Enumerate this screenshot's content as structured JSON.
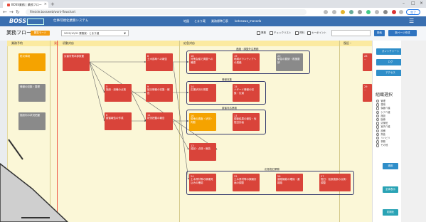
{
  "browser": {
    "tab_title": "BOSS業務 | 業務フロー",
    "url": "fileside.bossweb/work-flowchart",
    "done_label": "完了"
  },
  "app": {
    "logo": "BOSS",
    "logo_sub": "",
    "system_name": "仕事可視化業務システム",
    "nav": [
      "地図",
      "とまり蔵",
      "業務標準日表",
      "kotesawa_manada"
    ]
  },
  "toolbar": {
    "title": "業務フロー",
    "badge": "閲覧モード",
    "project": "2022/10/31 業務実：とまり蔵",
    "checks": [
      "業務",
      "チェックリスト",
      "資料",
      "キーポイント"
    ],
    "search_btn": "検索",
    "sheet_btn": "新ページ作成"
  },
  "columns": [
    "業務予約",
    "発注",
    "初動対応",
    "",
    "",
    "",
    " 応急対応",
    "",
    "",
    "",
    "復旧・"
  ],
  "colheaders": {
    "c1": "業務予約",
    "c2": "発注",
    "c3": "初動対応",
    "c4": "応急対応",
    "c5": "復旧・"
  },
  "groups": {
    "g1": "連絡・調整外注業務",
    "g2": "情報収集",
    "g3": "被害対応業務",
    "g4": "応急復旧業務"
  },
  "nodes": {
    "n1": "防災体制",
    "n2": "情報の収集・整理",
    "n3": "施設内の状況把握",
    "n4": "災害対策本部設置",
    "n5": "11\n対策調査班の確認\n...",
    "n6": "12\n被害状況の把握",
    "n7": "5\n施設・設備の点検",
    "n8": "6\n被害報告の作成",
    "n9": "8\n土木部局への報告",
    "n10": "9\n被災情報の収集・報告",
    "n11": "11\n状況把握の報告",
    "n12": "18\n対策会議で調整への確認",
    "n13": "19\n地域ボランティアへの連絡",
    "n14": "20\n緊急の要請・救援要請",
    "n15": "14\n応援状況の把握",
    "n16": "15\nハザード情報の収集・伝達",
    "n17": "16\n現地の調査・状況・判断",
    "n18": "17\n調査結果の報告・仮復旧計画",
    "n19": "13\n巡回・点検・報告",
    "n20": "24\n土木資材等の調達見込みの確認",
    "n21": "25\n土木資材等の調達計画の調整",
    "n22": "26\n道路機能の確保・避難路",
    "n23": "27\n復旧・仮設施設の点検・調整",
    "n24": "28\n...",
    "n25": "29\n..."
  },
  "panel": {
    "btn_top": "ガントチャート",
    "btn2": "ログ",
    "btn3": "アクセス",
    "title": "組織選択",
    "items": [
      "管理",
      "運用",
      "保健介護",
      "ケア介護",
      "施設",
      "医療",
      "清掃班",
      "室内介護",
      "設備",
      "栄養",
      "リハビリ",
      "事務",
      "その他"
    ],
    "apply": "適用",
    "all": "全体表示",
    "clear": "初期化"
  }
}
